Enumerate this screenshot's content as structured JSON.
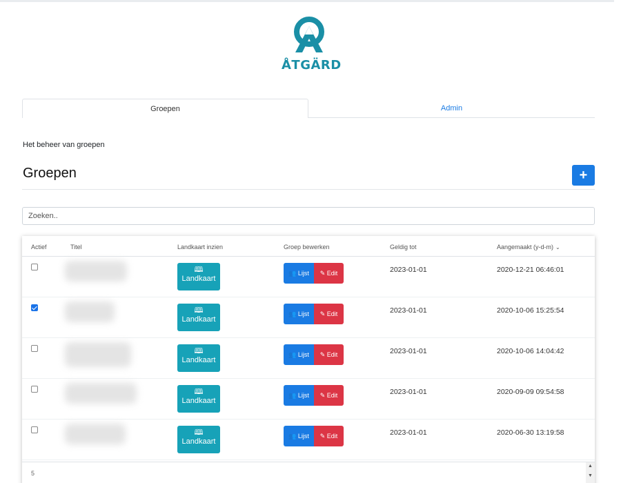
{
  "logo": {
    "text": "ÅTGÄRD",
    "color": "#1a8fa6"
  },
  "tabs": [
    {
      "label": "Groepen",
      "active": true
    },
    {
      "label": "Admin",
      "active": false
    }
  ],
  "subtitle": "Het beheer van groepen",
  "page_title": "Groepen",
  "add_button": {
    "icon": "plus-icon",
    "symbol": "+"
  },
  "search": {
    "placeholder": "Zoeken..",
    "value": ""
  },
  "table": {
    "headers": [
      "Actief",
      "Titel",
      "Landkaart inzien",
      "Groep bewerken",
      "Geldig tot",
      "Aangemaakt (y-d-m)"
    ],
    "sort_icon": "⌄",
    "map_button": {
      "icon": "map-icon",
      "symbol": "🕮",
      "label": "Landkaart"
    },
    "lijst_button": {
      "icon": "users-icon",
      "symbol": "👥",
      "label": "Lijst"
    },
    "edit_button": {
      "icon": "edit-icon",
      "symbol": "✎",
      "label": "Edit"
    },
    "rows": [
      {
        "active": false,
        "geldig_tot": "2023-01-01",
        "aangemaakt": "2020-12-21 06:46:01"
      },
      {
        "active": true,
        "geldig_tot": "2023-01-01",
        "aangemaakt": "2020-10-06 15:25:54"
      },
      {
        "active": false,
        "geldig_tot": "2023-01-01",
        "aangemaakt": "2020-10-06 14:04:42"
      },
      {
        "active": false,
        "geldig_tot": "2023-01-01",
        "aangemaakt": "2020-09-09 09:54:58"
      },
      {
        "active": false,
        "geldig_tot": "2023-01-01",
        "aangemaakt": "2020-06-30 13:19:58"
      }
    ],
    "count": "5"
  },
  "colors": {
    "primary": "#1a7be3",
    "danger": "#dc3545",
    "info": "#17a2b8"
  }
}
